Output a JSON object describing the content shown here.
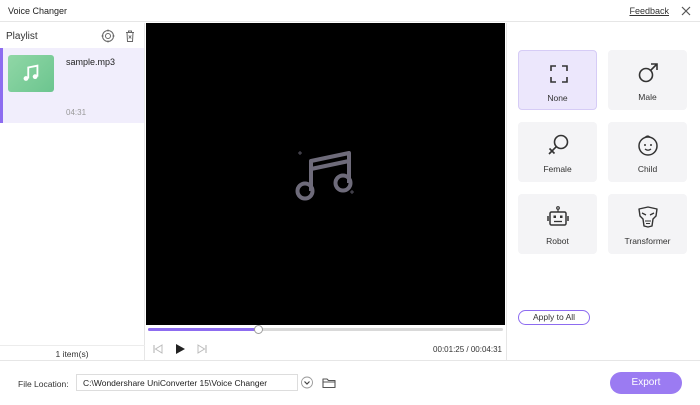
{
  "window": {
    "title": "Voice Changer",
    "feedback_label": "Feedback",
    "close_icon": "close-icon"
  },
  "playlist": {
    "title": "Playlist",
    "add_icon": "add-file-icon",
    "delete_icon": "trash-icon",
    "items": [
      {
        "name": "sample.mp3",
        "duration": "04:31",
        "thumbnail_icon": "music-note-icon"
      }
    ],
    "count_label": "1 item(s)"
  },
  "player": {
    "placeholder_icon": "music-note-icon",
    "progress": 0.31,
    "current_time": "00:01:25",
    "total_time": "00:04:31",
    "time_separator": " / "
  },
  "effects": {
    "items": [
      {
        "label": "None",
        "icon": "fullscreen-frame-icon",
        "selected": true
      },
      {
        "label": "Male",
        "icon": "male-symbol-icon",
        "selected": false
      },
      {
        "label": "Female",
        "icon": "female-symbol-icon",
        "selected": false
      },
      {
        "label": "Child",
        "icon": "child-face-icon",
        "selected": false
      },
      {
        "label": "Robot",
        "icon": "robot-icon",
        "selected": false
      },
      {
        "label": "Transformer",
        "icon": "transformer-icon",
        "selected": false
      }
    ],
    "apply_all_label": "Apply to All"
  },
  "footer": {
    "location_label": "File Location:",
    "location_value": "C:\\Wondershare UniConverter 15\\Voice Changer",
    "export_label": "Export"
  },
  "colors": {
    "accent": "#8d6cf0",
    "export_button": "#9b7bf2",
    "selected_effect_bg": "#ece7fc"
  }
}
